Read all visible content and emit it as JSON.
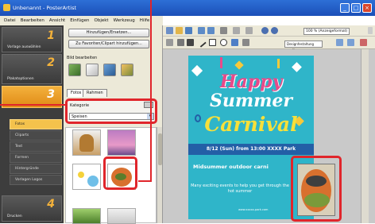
{
  "titlebar": {
    "title": "Unbenannt - PosterArtist"
  },
  "menubar": {
    "items": [
      "Datei",
      "Bearbeiten",
      "Ansicht",
      "Einfügen",
      "Objekt",
      "Werkzeug",
      "Hilfe"
    ]
  },
  "steps": [
    {
      "num": "1",
      "label": "Vorlage auswählen"
    },
    {
      "num": "2",
      "label": "Plakatoptionen"
    },
    {
      "num": "3",
      "label": ""
    },
    {
      "num": "4",
      "label": "Drucken"
    }
  ],
  "subitems": [
    "Fotos",
    "Cliparts",
    "Text",
    "Formen",
    "Hintergründe",
    "Vorlagen Logos"
  ],
  "midpanel": {
    "add_button": "Hinzufügen/Ersetzen...",
    "fav_button": "Zu Favoriten/Clipart hinzufügen...",
    "edit_label": "Bild bearbeiten",
    "tab_photos": "Fotos",
    "tab_frames": "Rahmen",
    "category_label": "Kategorie",
    "category_value": "Speisen"
  },
  "toolbar": {
    "zoom": "100 % (Anzeigeformat)",
    "font_hint": "Designfestaltung verfügen"
  },
  "poster": {
    "line1": "Happy",
    "line2": "Summer",
    "line3": "Carnival",
    "date": "8/12 (Sun) from 13:00  XXXX Park",
    "subtitle": "Midsummer outdoor carni",
    "desc": "Many exciting events to help you get through the hot summer",
    "url": "www.xxxxx-park.com"
  },
  "colors": {
    "accent": "#e0252b",
    "poster_bg": "#2fb5c9",
    "ribbon": "#235fa6",
    "step_active": "#f3b13c"
  }
}
